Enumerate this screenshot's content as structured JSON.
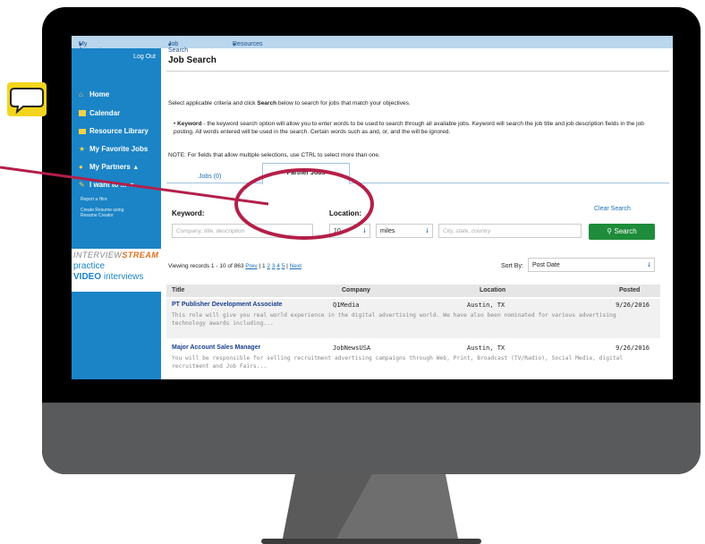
{
  "nav": {
    "my_account": "My Account",
    "job_search": "Job Search",
    "resources": "Resources",
    "caret": "▾"
  },
  "sidebar": {
    "logout": "Log Out",
    "items": [
      {
        "label": "Home",
        "icon": "home-icon"
      },
      {
        "label": "Calendar",
        "icon": "calendar-icon"
      },
      {
        "label": "Resource Library",
        "icon": "folder-icon"
      },
      {
        "label": "My Favorite Jobs",
        "icon": "star-icon"
      },
      {
        "label": "My Partners",
        "icon": "person-icon"
      },
      {
        "label": "I want to ...",
        "icon": "tools-icon"
      }
    ],
    "sub_items": [
      "Report a Hire",
      "Create Resume using",
      "Resume Creator"
    ],
    "stream": {
      "prefix": "INTERVIEW",
      "highlight": "STREAM",
      "practice": "practice",
      "video": "VIDEO",
      "interviews": "interviews"
    }
  },
  "main": {
    "title": "Job Search",
    "instructions_prefix": "Select applicable criteria and click ",
    "instructions_bold": "Search",
    "instructions_suffix": " below to search for jobs that match your objectives.",
    "keyword_label": "Keyword",
    "keyword_text": " - the keyword search option will allow you to enter words to be used to search through all available jobs. Keyword will search the job title and job description fields in the job posting. All words entered will be used in the search. Certain words such as and, or, and the will be ignored.",
    "note": "NOTE: For fields that allow multiple selections, use CTRL to select more than one.",
    "tabs": {
      "jobs": "Jobs (0)",
      "partner": "Partner Jobs"
    },
    "form": {
      "keyword_label": "Keyword:",
      "keyword_placeholder": "Company, title, description",
      "location_label": "Location:",
      "distance_value": "10",
      "unit_value": "miles",
      "location_placeholder": "City, state, country",
      "clear": "Clear Search",
      "search": "Search"
    },
    "viewing": "Viewing records 1 - 10 of 863",
    "pager": {
      "prev": "Prev",
      "sep": "|",
      "current": "1",
      "pages": [
        "2",
        "3",
        "4",
        "5"
      ],
      "next": "Next"
    },
    "sort": {
      "label": "Sort By:",
      "value": "Post Date"
    },
    "table": {
      "headers": [
        "Title",
        "Company",
        "Location",
        "Posted"
      ],
      "rows": [
        {
          "title": "PT Publisher Development Associate",
          "company": "Q1Media",
          "location": "Austin, TX",
          "posted": "9/26/2016",
          "desc": "This role will give you real world experience in the digital advertising world. We have also been nominated for various advertising technology awards including..."
        },
        {
          "title": "Major Account Sales Manager",
          "company": "JobNewsUSA",
          "location": "Austin, TX",
          "posted": "9/26/2016",
          "desc": "You will be responsible for selling recruitment advertising campaigns through Web, Print, Broadcast (TV/Radio), Social Media, digital recruitment and Job Fairs..."
        }
      ]
    }
  },
  "colors": {
    "sidebar": "#1b84c6",
    "accent_green": "#1e8c3a",
    "callout": "#b41f4a",
    "bubble": "#f3d51d"
  }
}
